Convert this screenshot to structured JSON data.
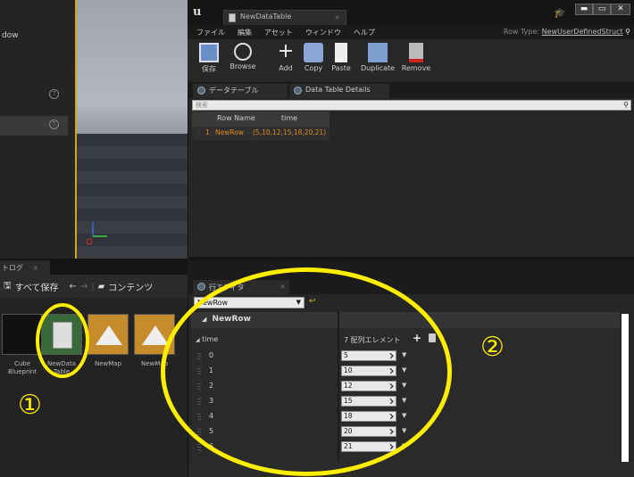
{
  "left_panel": {
    "partial_text": "dow"
  },
  "content_browser": {
    "tab_label": "トログ",
    "save_all": "すべて保存",
    "content_label": "コンテンツ",
    "assets": [
      {
        "label": "Cube Blueprint"
      },
      {
        "label": "NewData Table"
      },
      {
        "label": "NewMap"
      },
      {
        "label": "NewMap"
      }
    ]
  },
  "editor": {
    "tab_title": "NewDataTable",
    "menu": [
      "ファイル",
      "編集",
      "アセット",
      "ウィンドウ",
      "ヘルプ"
    ],
    "row_type_label": "Row Type:",
    "row_type_value": "NewUserDefinedStruct",
    "toolbar": [
      "保存",
      "Browse",
      "Add",
      "Copy",
      "Paste",
      "Duplicate",
      "Remove"
    ],
    "panel_tabs": [
      "データテーブル",
      "Data Table Details"
    ],
    "search_placeholder": "検索",
    "table": {
      "columns": [
        "Row Name",
        "time"
      ],
      "rows": [
        {
          "index": "1",
          "name": "NewRow",
          "time": "(5,10,12,15,18,20,21)"
        }
      ]
    },
    "row_editor_tab": "行エディタ",
    "row_select": "NewRow",
    "details_header": "NewRow",
    "property_name": "time",
    "array_count": "7 配列エレメント",
    "elements": [
      {
        "index": "0",
        "value": "5"
      },
      {
        "index": "1",
        "value": "10"
      },
      {
        "index": "2",
        "value": "12"
      },
      {
        "index": "3",
        "value": "15"
      },
      {
        "index": "4",
        "value": "18"
      },
      {
        "index": "5",
        "value": "20"
      },
      {
        "index": "6",
        "value": "21"
      }
    ]
  },
  "annotations": {
    "label1": "①",
    "label2": "②"
  },
  "colors": {
    "highlight": "#ffee00",
    "row_text": "#e08a1a"
  }
}
